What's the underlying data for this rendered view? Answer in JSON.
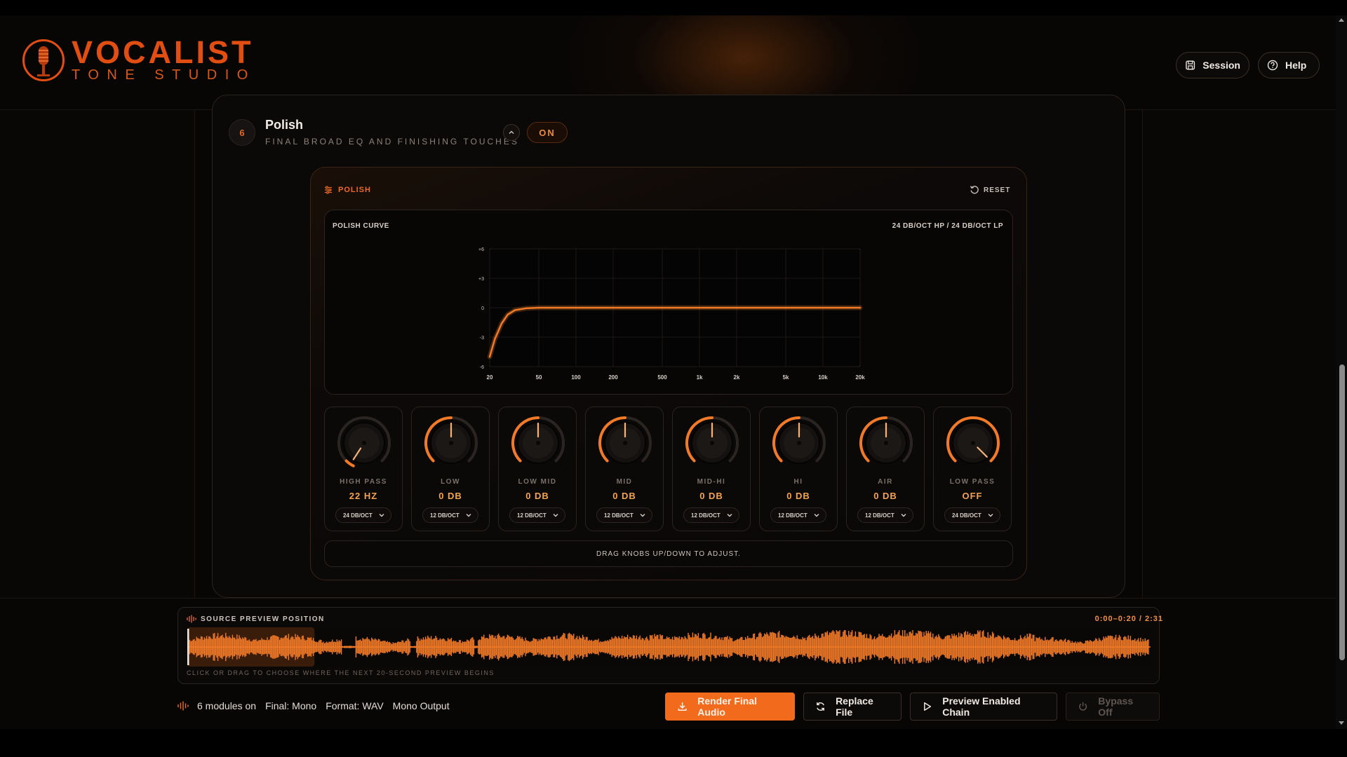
{
  "brand": {
    "title": "VOCALIST",
    "subtitle": "TONE STUDIO"
  },
  "header": {
    "session_label": "Session",
    "help_label": "Help"
  },
  "module": {
    "number": "6",
    "title": "Polish",
    "subtitle": "FINAL BROAD EQ AND FINISHING TOUCHES",
    "toggle_label": "ON"
  },
  "panel": {
    "label": "POLISH",
    "reset_label": "RESET",
    "curve_title": "POLISH CURVE",
    "curve_mode": "24 DB/OCT HP / 24 DB/OCT LP",
    "hint": "DRAG KNOBS UP/DOWN TO ADJUST."
  },
  "chart_data": {
    "type": "line",
    "title": "POLISH CURVE",
    "x_scale": "log",
    "x_ticks": [
      "20",
      "50",
      "100",
      "200",
      "500",
      "1k",
      "2k",
      "5k",
      "10k",
      "20k"
    ],
    "y_ticks": [
      "+6",
      "+3",
      "0",
      "-3",
      "-6"
    ],
    "xlim": [
      20,
      20000
    ],
    "ylim": [
      -6,
      6
    ],
    "series": [
      {
        "color": "#f07a28",
        "x": [
          20,
          22,
          25,
          28,
          32,
          40,
          50,
          100,
          1000,
          20000
        ],
        "y": [
          -5,
          -3.2,
          -1.6,
          -0.7,
          -0.25,
          -0.05,
          0,
          0,
          0,
          0
        ]
      }
    ],
    "grid": true
  },
  "knobs": [
    {
      "label": "HIGH PASS",
      "value": "22 HZ",
      "slope": "24 DB/OCT",
      "fill": 0.0
    },
    {
      "label": "LOW",
      "value": "0 DB",
      "slope": "12 DB/OCT",
      "fill": 0.5
    },
    {
      "label": "LOW MID",
      "value": "0 DB",
      "slope": "12 DB/OCT",
      "fill": 0.5
    },
    {
      "label": "MID",
      "value": "0 DB",
      "slope": "12 DB/OCT",
      "fill": 0.5
    },
    {
      "label": "MID-HI",
      "value": "0 DB",
      "slope": "12 DB/OCT",
      "fill": 0.5
    },
    {
      "label": "HI",
      "value": "0 DB",
      "slope": "12 DB/OCT",
      "fill": 0.5
    },
    {
      "label": "AIR",
      "value": "0 DB",
      "slope": "12 DB/OCT",
      "fill": 0.5
    },
    {
      "label": "LOW PASS",
      "value": "OFF",
      "slope": "24 DB/OCT",
      "fill": 1.0
    }
  ],
  "waveform": {
    "title": "SOURCE PREVIEW POSITION",
    "time": "0:00–0:20 / 2:31",
    "help": "CLICK OR DRAG TO CHOOSE WHERE THE NEXT 20-SECOND PREVIEW BEGINS",
    "selection_fraction": 0.132
  },
  "status": {
    "modules": "6 modules on",
    "final": "Final: Mono",
    "format": "Format: WAV",
    "output": "Mono Output"
  },
  "actions": {
    "render": "Render Final Audio",
    "replace": "Replace File",
    "preview": "Preview Enabled Chain",
    "bypass": "Bypass Off"
  },
  "colors": {
    "accent": "#f26a1b",
    "accent_light": "#f4a24e",
    "background": "#070605"
  }
}
